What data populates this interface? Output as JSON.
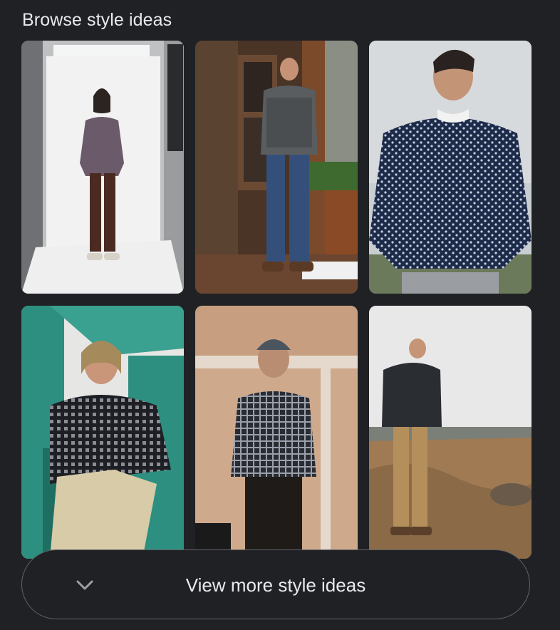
{
  "section": {
    "title": "Browse style ideas"
  },
  "images": [
    {
      "id": "studio-purple-sweater",
      "alt": ""
    },
    {
      "id": "porch-gray-sweater",
      "alt": ""
    },
    {
      "id": "navy-birdseye-sweater",
      "alt": ""
    },
    {
      "id": "green-truck-sweater",
      "alt": ""
    },
    {
      "id": "beanie-gingham-sweater",
      "alt": ""
    },
    {
      "id": "landscape-sweater",
      "alt": ""
    }
  ],
  "footer": {
    "more_label": "View more style ideas",
    "icon": "chevron-down-icon"
  },
  "colors": {
    "background": "#202124",
    "text": "#e8eaed",
    "border": "#5f6368"
  }
}
